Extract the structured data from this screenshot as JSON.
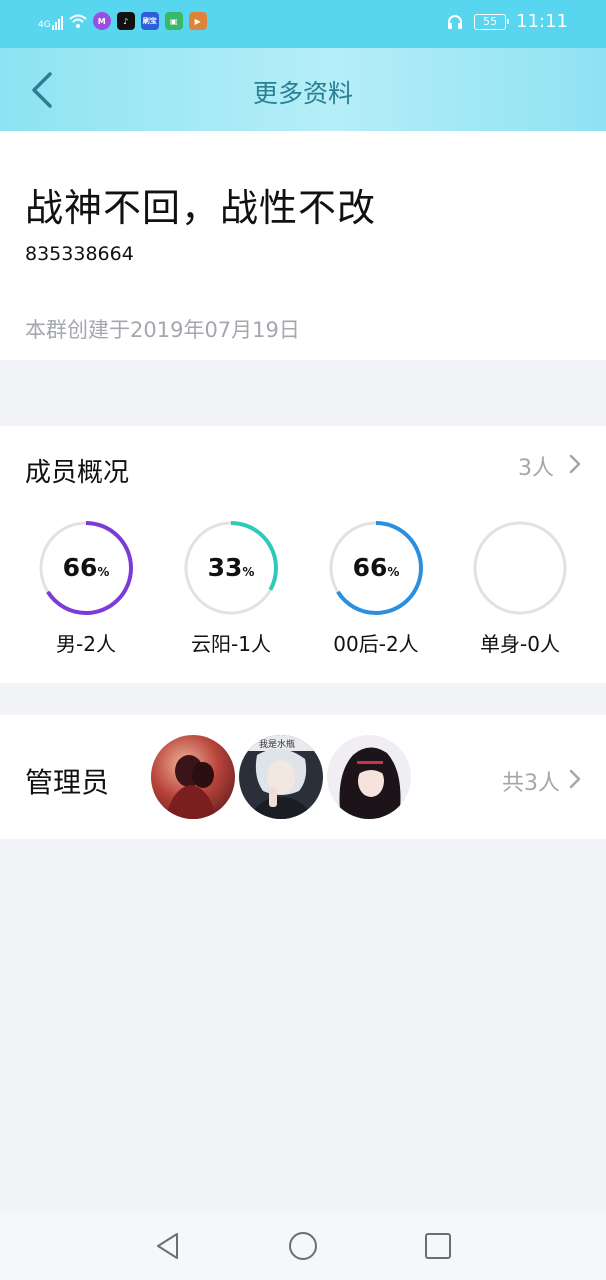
{
  "status_bar": {
    "network": "4G",
    "app_icons": [
      "M",
      "♪",
      "刷宝",
      "▣",
      "▶"
    ],
    "battery": "55",
    "time": "11:11"
  },
  "navbar": {
    "title": "更多资料"
  },
  "group": {
    "name": "战神不回，战性不改",
    "id": "835338664",
    "created": "本群创建于2019年07月19日"
  },
  "members": {
    "title": "成员概况",
    "count": "3人",
    "stats": [
      {
        "pct": "66",
        "unit": "%",
        "label": "男-2人",
        "fraction": 0.66,
        "color": "#7b3bd6"
      },
      {
        "pct": "33",
        "unit": "%",
        "label": "云阳-1人",
        "fraction": 0.33,
        "color": "#2ec9b8"
      },
      {
        "pct": "66",
        "unit": "%",
        "label": "00后-2人",
        "fraction": 0.66,
        "color": "#2b8fe0"
      },
      {
        "pct": "",
        "unit": "",
        "label": "单身-0人",
        "fraction": 0,
        "color": "#dddddd"
      }
    ]
  },
  "admins": {
    "title": "管理员",
    "count": "共3人",
    "avatar_watermark": "我是水瓶"
  },
  "colors": {
    "status_bar": "#58d5ef",
    "nav_title": "#2a7f93",
    "muted_text": "#a4a7ae",
    "page_bg": "#f3f4f8"
  },
  "icons": {
    "back": "chevron-left-icon",
    "member_arrow": "chevron-right-icon",
    "admin_arrow": "chevron-right-icon",
    "sys_back": "triangle-back-icon",
    "sys_home": "circle-home-icon",
    "sys_recent": "square-recent-icon"
  }
}
